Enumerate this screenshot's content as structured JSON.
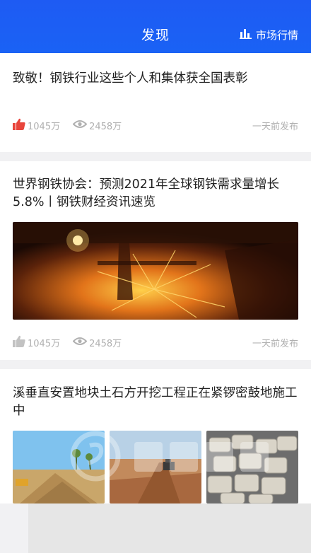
{
  "header": {
    "title": "发现",
    "market_label": "市场行情"
  },
  "articles": [
    {
      "title": "致敬！钢铁行业这些个人和集体获全国表彰",
      "likes": "1045万",
      "views": "2458万",
      "time": "一天前发布",
      "like_active": true
    },
    {
      "title": "世界钢铁协会：预测2021年全球钢铁需求量增长5.8%丨钢铁财经资讯速览",
      "likes": "1045万",
      "views": "2458万",
      "time": "一天前发布",
      "like_active": false
    },
    {
      "title": "溪垂直安置地块土石方开挖工程正在紧锣密鼓地施工中"
    }
  ],
  "colors": {
    "brand_blue": "#1a5cf5",
    "like_red": "#e8453c",
    "meta_gray": "#b0b0b0"
  }
}
